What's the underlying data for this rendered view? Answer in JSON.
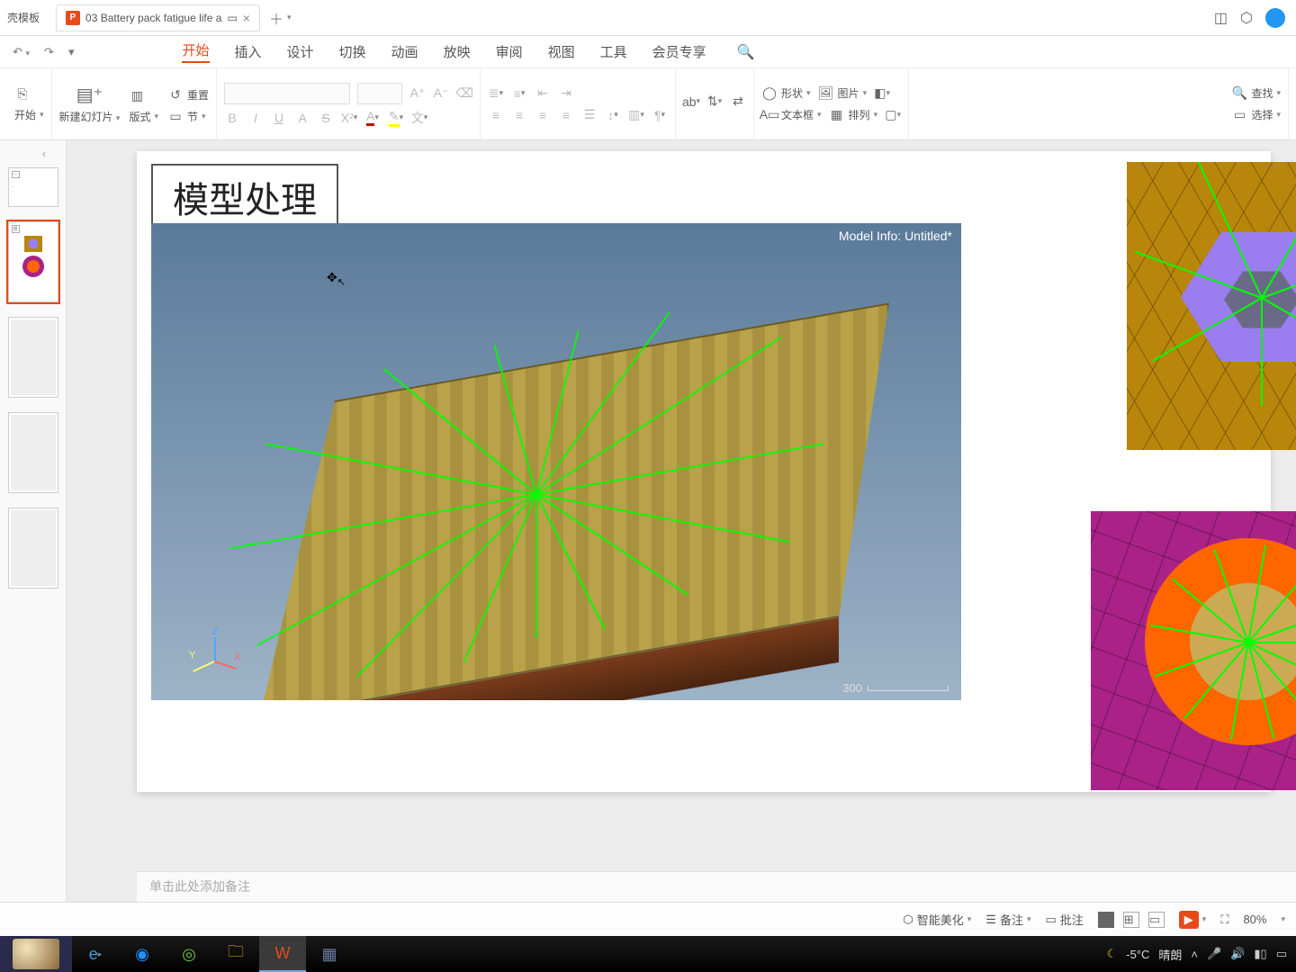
{
  "tabs": {
    "template_tab": "壳模板",
    "file_tab": "03 Battery pack fatigue life a",
    "file_icon_letter": "P"
  },
  "menu": {
    "items": [
      "开始",
      "插入",
      "设计",
      "切换",
      "动画",
      "放映",
      "审阅",
      "视图",
      "工具",
      "会员专享"
    ],
    "active_index": 0
  },
  "ribbon": {
    "start_dd": "开始",
    "new_slide": "新建幻灯片",
    "layout": "版式",
    "reset": "重置",
    "section": "节",
    "shape": "形状",
    "picture": "图片",
    "textbox": "文本框",
    "arrange": "排列",
    "find": "查找",
    "select": "选择",
    "font_fmt_tip": "文"
  },
  "slide": {
    "title": "模型处理",
    "model_info": "Model Info: Untitled*",
    "scale_value": "300",
    "axis": {
      "x": "X",
      "y": "Y",
      "z": "Z"
    }
  },
  "notes_placeholder": "单击此处添加备注",
  "status": {
    "smart": "智能美化",
    "notes": "备注",
    "comments": "批注",
    "zoom": "80%"
  },
  "taskbar": {
    "weather_temp": "-5°C",
    "weather_cond": "晴朗"
  }
}
